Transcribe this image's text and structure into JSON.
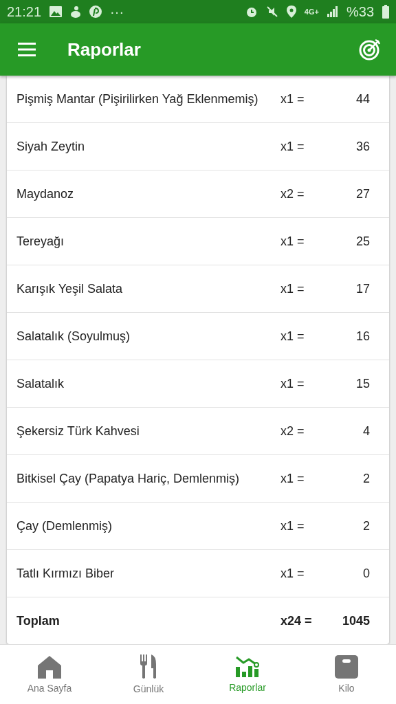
{
  "status_bar": {
    "time": "21:21",
    "more": "···",
    "network": "4G+",
    "battery": "%33"
  },
  "app_bar": {
    "title": "Raporlar"
  },
  "table": {
    "rows": [
      {
        "name": "Pişmiş Mantar (Pişirilirken Yağ Eklenmemiş)",
        "qty": "x1 =",
        "value": "44"
      },
      {
        "name": "Siyah Zeytin",
        "qty": "x1 =",
        "value": "36"
      },
      {
        "name": "Maydanoz",
        "qty": "x2 =",
        "value": "27"
      },
      {
        "name": "Tereyağı",
        "qty": "x1 =",
        "value": "25"
      },
      {
        "name": "Karışık Yeşil Salata",
        "qty": "x1 =",
        "value": "17"
      },
      {
        "name": "Salatalık (Soyulmuş)",
        "qty": "x1 =",
        "value": "16"
      },
      {
        "name": "Salatalık",
        "qty": "x1 =",
        "value": "15"
      },
      {
        "name": "Şekersiz Türk Kahvesi",
        "qty": "x2 =",
        "value": "4"
      },
      {
        "name": "Bitkisel Çay (Papatya Hariç, Demlenmiş)",
        "qty": "x1 =",
        "value": "2"
      },
      {
        "name": "Çay (Demlenmiş)",
        "qty": "x1 =",
        "value": "2"
      },
      {
        "name": "Tatlı Kırmızı Biber",
        "qty": "x1 =",
        "value": "0"
      }
    ],
    "total": {
      "name": "Toplam",
      "qty": "x24 =",
      "value": "1045"
    }
  },
  "bottom_nav": [
    {
      "label": "Ana Sayfa",
      "kind": "home",
      "selected": false
    },
    {
      "label": "Günlük",
      "kind": "diary",
      "selected": false
    },
    {
      "label": "Raporlar",
      "kind": "reports",
      "selected": true
    },
    {
      "label": "Kilo",
      "kind": "weight",
      "selected": false
    }
  ]
}
